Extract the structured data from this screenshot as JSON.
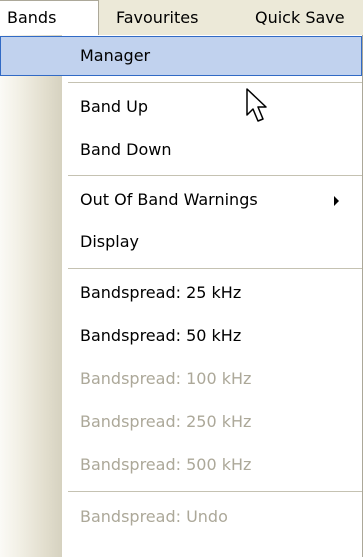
{
  "menubar": {
    "items": [
      {
        "label": "Bands",
        "open": true
      },
      {
        "label": "Favourites"
      },
      {
        "label": "Quick Save"
      }
    ]
  },
  "menu": {
    "items": [
      {
        "label": "Manager",
        "state": "highlighted"
      },
      {
        "label": "Band Up"
      },
      {
        "label": "Band Down"
      },
      {
        "label": "Out Of Band Warnings",
        "submenu": true
      },
      {
        "label": "Display"
      },
      {
        "label": "Bandspread: 25 kHz"
      },
      {
        "label": "Bandspread: 50 kHz"
      },
      {
        "label": "Bandspread: 100 kHz",
        "state": "disabled"
      },
      {
        "label": "Bandspread: 250 kHz",
        "state": "disabled"
      },
      {
        "label": "Bandspread: 500 kHz",
        "state": "disabled"
      },
      {
        "label": "Bandspread: Undo",
        "state": "disabled"
      }
    ]
  },
  "colors": {
    "menubar_bg": "#ece9d8",
    "highlight_bg": "#c1d2ee",
    "highlight_border": "#316ac5",
    "disabled_text": "#aca899"
  },
  "icons": {
    "submenu": "submenu-arrow-icon",
    "cursor": "mouse-pointer-icon"
  }
}
